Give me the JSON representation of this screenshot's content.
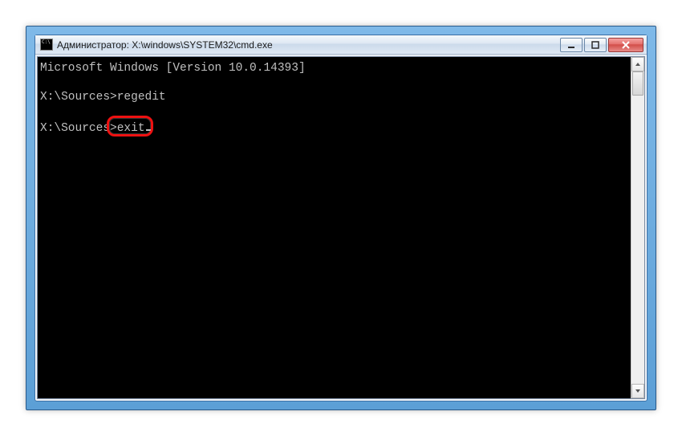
{
  "window": {
    "title": "Администратор: X:\\windows\\SYSTEM32\\cmd.exe"
  },
  "terminal": {
    "line0": "Microsoft Windows [Version 10.0.14393]",
    "line1": "",
    "line2_prompt": "X:\\Sources>",
    "line2_cmd": "regedit",
    "line3": "",
    "line4_prompt": "X:\\Sources>",
    "line4_cmd": "exit"
  },
  "highlight": {
    "target": "exit"
  }
}
